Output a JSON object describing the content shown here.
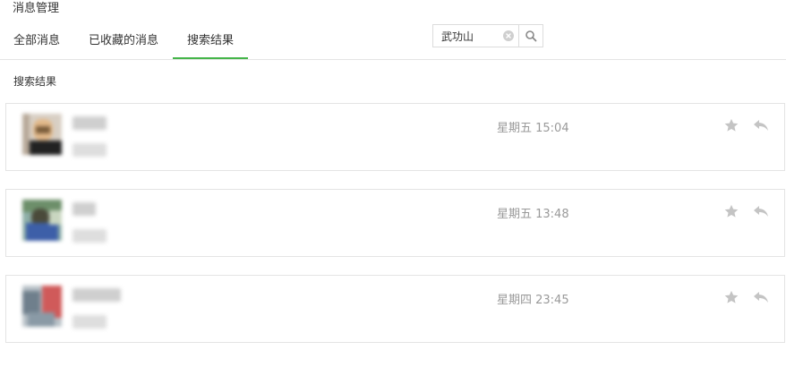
{
  "page": {
    "title": "消息管理"
  },
  "tabs": [
    {
      "label": "全部消息",
      "active": false
    },
    {
      "label": "已收藏的消息",
      "active": false
    },
    {
      "label": "搜索结果",
      "active": true
    }
  ],
  "search": {
    "value": "武功山",
    "placeholder": ""
  },
  "section": {
    "label": "搜索结果"
  },
  "messages": [
    {
      "time": "星期五 15:04",
      "starred": false
    },
    {
      "time": "星期五 13:48",
      "starred": false
    },
    {
      "time": "星期四 23:45",
      "starred": false
    }
  ],
  "icons": {
    "clear": "clear-icon",
    "search": "search-icon",
    "star": "star-icon",
    "reply": "reply-icon"
  },
  "colors": {
    "accent": "#44b549",
    "icon": "#c4c4c4",
    "time": "#999999",
    "border": "#e4e4e4"
  }
}
